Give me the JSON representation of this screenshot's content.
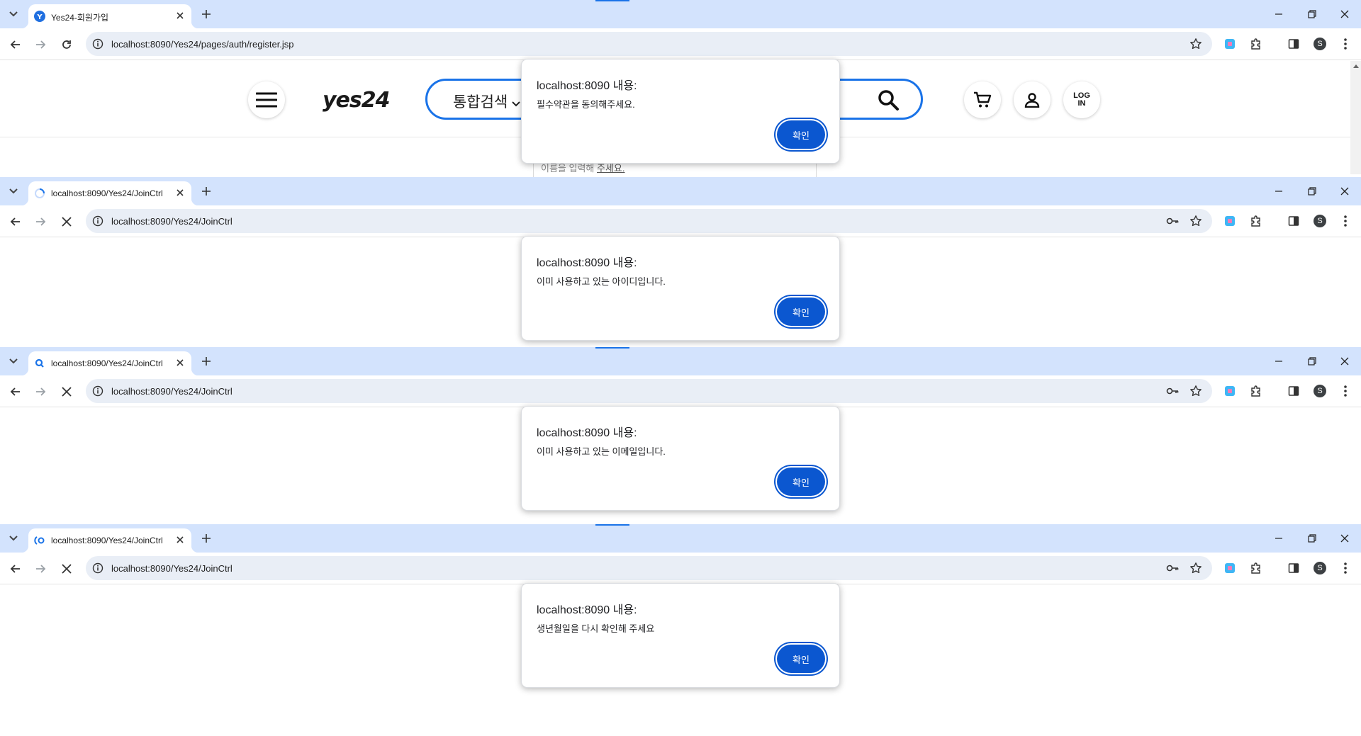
{
  "windows": [
    {
      "tab_title": "Yes24-회원가입",
      "url": "localhost:8090/Yes24/pages/auth/register.jsp",
      "loading": false,
      "alert": {
        "title": "localhost:8090 내용:",
        "message": "필수약관을 동의해주세요.",
        "ok_label": "확인"
      }
    },
    {
      "tab_title": "localhost:8090/Yes24/JoinCtrl",
      "url": "localhost:8090/Yes24/JoinCtrl",
      "loading": true,
      "alert": {
        "title": "localhost:8090 내용:",
        "message": "이미 사용하고 있는 아이디입니다.",
        "ok_label": "확인"
      }
    },
    {
      "tab_title": "localhost:8090/Yes24/JoinCtrl",
      "url": "localhost:8090/Yes24/JoinCtrl",
      "loading": true,
      "alert": {
        "title": "localhost:8090 내용:",
        "message": "이미 사용하고 있는 이메일입니다.",
        "ok_label": "확인"
      }
    },
    {
      "tab_title": "localhost:8090/Yes24/JoinCtrl",
      "url": "localhost:8090/Yes24/JoinCtrl",
      "loading": true,
      "alert": {
        "title": "localhost:8090 내용:",
        "message": "생년월일을 다시 확인해 주세요",
        "ok_label": "확인"
      }
    }
  ],
  "site": {
    "logo": "yes24",
    "search_category": "통합검색",
    "login_label_line1": "LOG",
    "login_label_line2": "IN",
    "name_hint_pre": "이름을 입력해",
    "name_hint_link": "주세요."
  },
  "profile_initial": "S",
  "colors": {
    "tab_strip": "#d3e3fd",
    "accent": "#1a73e8",
    "ok_button": "#0b57d0"
  }
}
